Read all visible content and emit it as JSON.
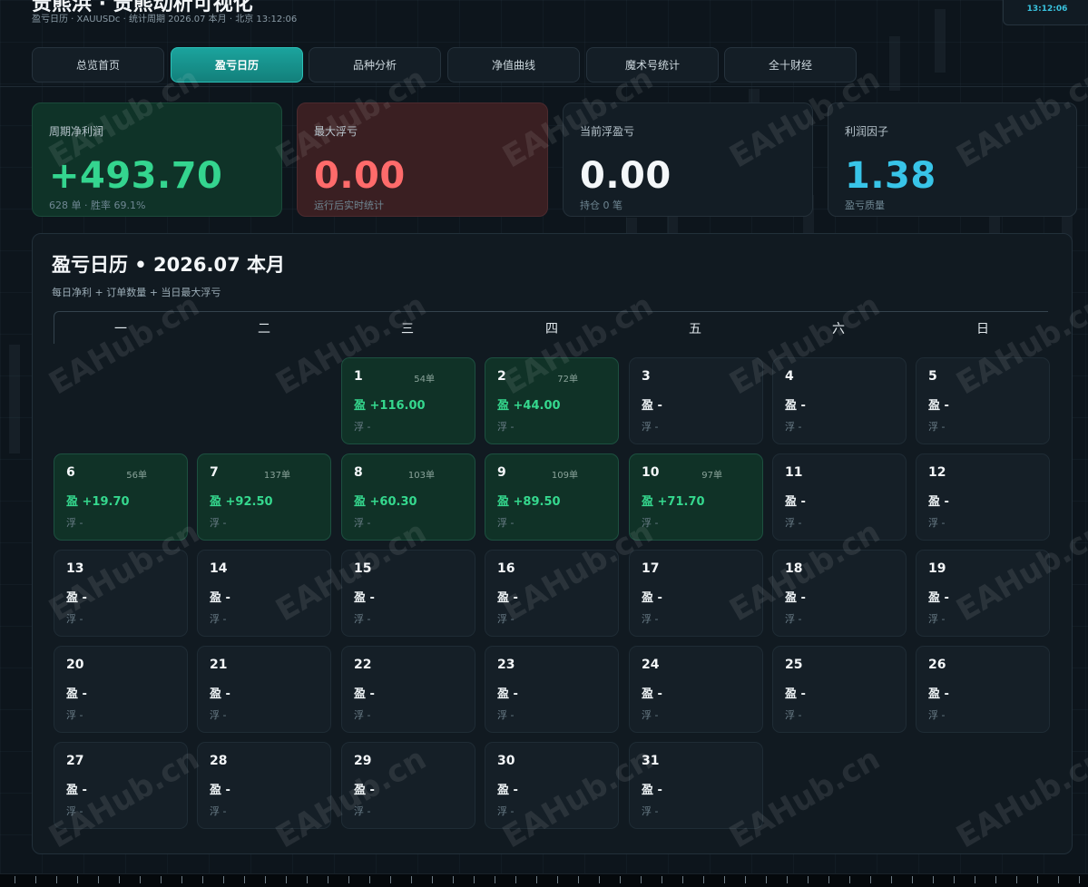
{
  "header": {
    "title": "贵熊浜 · 贵熊动析可视化",
    "subtitle": "盈亏日历 · XAUUSDc · 统计周期 2026.07 本月 · 北京 13:12:06",
    "clock": "13:12:06"
  },
  "tabs": [
    {
      "label": "总览首页",
      "active": false
    },
    {
      "label": "盈亏日历",
      "active": true
    },
    {
      "label": "品种分析",
      "active": false
    },
    {
      "label": "净值曲线",
      "active": false
    },
    {
      "label": "魔术号统计",
      "active": false
    },
    {
      "label": "全十财经",
      "active": false
    }
  ],
  "kpis": [
    {
      "label": "周期净利润",
      "value": "+493.70",
      "sub": "628 单 · 胜率 69.1%"
    },
    {
      "label": "最大浮亏",
      "value": "0.00",
      "sub": "运行后实时统计"
    },
    {
      "label": "当前浮盈亏",
      "value": "0.00",
      "sub": "持仓 0 笔"
    },
    {
      "label": "利润因子",
      "value": "1.38",
      "sub": "盈亏质量"
    }
  ],
  "calendar": {
    "title": "盈亏日历 • 2026.07 本月",
    "subtitle": "每日净利 + 订单数量 + 当日最大浮亏",
    "weekdays": [
      "一",
      "二",
      "三",
      "四",
      "五",
      "六",
      "日"
    ],
    "days": [
      {
        "day": "1",
        "orders": "54单",
        "pl": "盈 +116.00",
        "float": "浮 -"
      },
      {
        "day": "2",
        "orders": "72单",
        "pl": "盈 +44.00",
        "float": "浮 -"
      },
      {
        "day": "3",
        "orders": "",
        "pl": "盈 -",
        "float": "浮 -"
      },
      {
        "day": "4",
        "orders": "",
        "pl": "盈 -",
        "float": "浮 -"
      },
      {
        "day": "5",
        "orders": "",
        "pl": "盈 -",
        "float": "浮 -"
      },
      {
        "day": "6",
        "orders": "56单",
        "pl": "盈 +19.70",
        "float": "浮 -"
      },
      {
        "day": "7",
        "orders": "137单",
        "pl": "盈 +92.50",
        "float": "浮 -"
      },
      {
        "day": "8",
        "orders": "103单",
        "pl": "盈 +60.30",
        "float": "浮 -"
      },
      {
        "day": "9",
        "orders": "109单",
        "pl": "盈 +89.50",
        "float": "浮 -"
      },
      {
        "day": "10",
        "orders": "97单",
        "pl": "盈 +71.70",
        "float": "浮 -"
      },
      {
        "day": "11",
        "orders": "",
        "pl": "盈 -",
        "float": "浮 -"
      },
      {
        "day": "12",
        "orders": "",
        "pl": "盈 -",
        "float": "浮 -"
      },
      {
        "day": "13",
        "orders": "",
        "pl": "盈 -",
        "float": "浮 -"
      },
      {
        "day": "14",
        "orders": "",
        "pl": "盈 -",
        "float": "浮 -"
      },
      {
        "day": "15",
        "orders": "",
        "pl": "盈 -",
        "float": "浮 -"
      },
      {
        "day": "16",
        "orders": "",
        "pl": "盈 -",
        "float": "浮 -"
      },
      {
        "day": "17",
        "orders": "",
        "pl": "盈 -",
        "float": "浮 -"
      },
      {
        "day": "18",
        "orders": "",
        "pl": "盈 -",
        "float": "浮 -"
      },
      {
        "day": "19",
        "orders": "",
        "pl": "盈 -",
        "float": "浮 -"
      },
      {
        "day": "20",
        "orders": "",
        "pl": "盈 -",
        "float": "浮 -"
      },
      {
        "day": "21",
        "orders": "",
        "pl": "盈 -",
        "float": "浮 -"
      },
      {
        "day": "22",
        "orders": "",
        "pl": "盈 -",
        "float": "浮 -"
      },
      {
        "day": "23",
        "orders": "",
        "pl": "盈 -",
        "float": "浮 -"
      },
      {
        "day": "24",
        "orders": "",
        "pl": "盈 -",
        "float": "浮 -"
      },
      {
        "day": "25",
        "orders": "",
        "pl": "盈 -",
        "float": "浮 -"
      },
      {
        "day": "26",
        "orders": "",
        "pl": "盈 -",
        "float": "浮 -"
      },
      {
        "day": "27",
        "orders": "",
        "pl": "盈 -",
        "float": "浮 -"
      },
      {
        "day": "28",
        "orders": "",
        "pl": "盈 -",
        "float": "浮 -"
      },
      {
        "day": "29",
        "orders": "",
        "pl": "盈 -",
        "float": "浮 -"
      },
      {
        "day": "30",
        "orders": "",
        "pl": "盈 -",
        "float": "浮 -"
      },
      {
        "day": "31",
        "orders": "",
        "pl": "盈 -",
        "float": "浮 -"
      }
    ]
  },
  "watermark": "EAHub.cn",
  "colors": {
    "accent": "#1ba39d",
    "profit": "#34d58f",
    "loss": "#ff6b6b",
    "info": "#38c4e8"
  }
}
